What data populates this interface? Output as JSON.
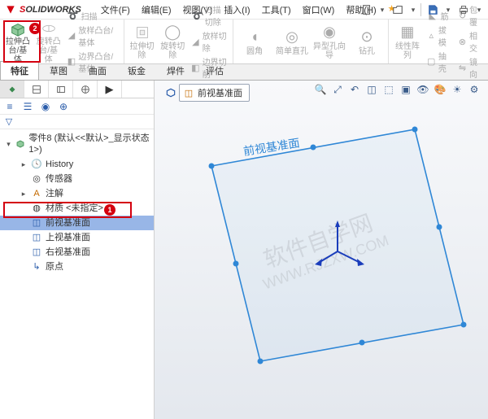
{
  "app": {
    "brand_s": "S",
    "brand_rest": "OLIDWORKS"
  },
  "menus": [
    "文件(F)",
    "编辑(E)",
    "视图(V)",
    "插入(I)",
    "工具(T)",
    "窗口(W)",
    "帮助(H)"
  ],
  "qat": {
    "star": "★"
  },
  "ribbon": {
    "g1": {
      "extrude": "拉伸凸台/基体",
      "revolve": "旋转凸台/基体",
      "sweep": "扫描",
      "loft": "放样凸台/基体",
      "boundary": "边界凸台/基体"
    },
    "g2": {
      "extrude_cut": "拉伸切除",
      "revolve_cut": "旋转切除",
      "sweep_cut": "扫描切除",
      "loft_cut": "放样切除",
      "boundary_cut": "边界切削"
    },
    "g3": {
      "fillet": "圆角",
      "simple_hole": "简单直孔",
      "hole_wizard": "异型孔向导",
      "bore": "钻孔"
    },
    "g4": {
      "pattern": "线性阵列",
      "rib": "筋",
      "draft": "拔模",
      "shell": "抽壳",
      "wrap": "包覆",
      "intersect": "相交",
      "mirror": "镜向"
    }
  },
  "tabs": [
    "特征",
    "草图",
    "曲面",
    "钣金",
    "焊件",
    "评估"
  ],
  "doc_title": "零件8 (默认<<默认>_显示状态 1>)",
  "tree": {
    "history": "History",
    "sensors": "传感器",
    "annotations": "注解",
    "material": "材质 <未指定>",
    "front_plane": "前视基准面",
    "top_plane": "上视基准面",
    "right_plane": "右视基准面",
    "origin": "原点"
  },
  "breadcrumb": {
    "label": "前视基准面"
  },
  "watermark": {
    "l1": "软件自学网",
    "l2": "WWW.RJZXW.COM"
  },
  "badges": {
    "one": "1",
    "two": "2"
  },
  "plane_annot": "前视基准面"
}
